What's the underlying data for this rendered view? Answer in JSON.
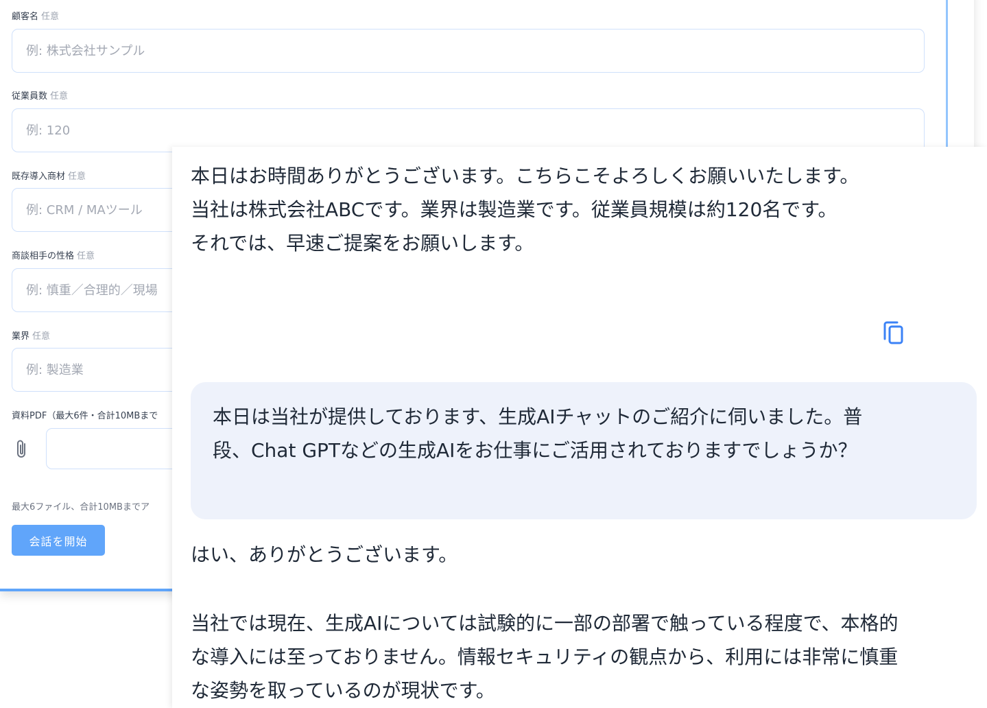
{
  "form": {
    "fields": [
      {
        "label": "顧客名",
        "optional": "任意",
        "placeholder": "例: 株式会社サンプル"
      },
      {
        "label": "従業員数",
        "optional": "任意",
        "placeholder": "例: 120"
      },
      {
        "label": "既存導入商材",
        "optional": "任意",
        "placeholder": "例: CRM / MAツール"
      },
      {
        "label": "商談相手の性格",
        "optional": "任意",
        "placeholder": "例: 慎重／合理的／現場"
      },
      {
        "label": "業界",
        "optional": "任意",
        "placeholder": "例: 製造業"
      }
    ],
    "pdf_label": "資料PDF（最大6件・合計10MBまで",
    "upload_note": "最大6ファイル、合計10MBまでア",
    "start_button": "会話を開始",
    "accent_color": "#60a5fa",
    "attach_icon": "paperclip-icon"
  },
  "chat": {
    "messages": [
      {
        "role": "user",
        "lines": [
          "本日はお時間ありがとうございます。こちらこそよろしくお願いいたします。",
          "当社は株式会社ABCです。業界は製造業です。従業員規模は約120名です。",
          "それでは、早速ご提案をお願いします。"
        ]
      },
      {
        "role": "assistant",
        "lines": [
          "本日は当社が提供しております、生成AIチャットのご紹介に伺いました。普",
          "段、Chat GPTなどの生成AIをお仕事にご活用されておりますでしょうか？"
        ]
      },
      {
        "role": "user",
        "paragraphs": [
          {
            "lines": [
              "はい、ありがとうございます。"
            ]
          },
          {
            "lines": [
              "当社では現在、生成AIについては試験的に一部の部署で触っている程度で、本格的",
              "な導入には至っておりません。情報セキュリティの観点から、利用には非常に慎重",
              "な姿勢を取っているのが現状です。"
            ]
          }
        ]
      }
    ],
    "copy_icon": "copy-icon",
    "bubble_color": "#eef2fb",
    "icon_color": "#3b82f6"
  }
}
